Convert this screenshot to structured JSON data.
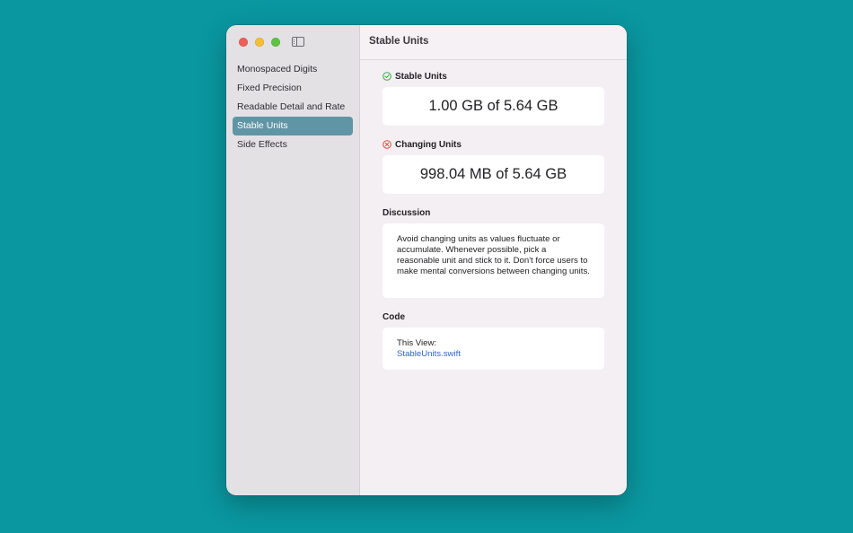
{
  "window": {
    "title": "Stable Units",
    "traffic_colors": {
      "close": "#ee5f58",
      "minimize": "#f7be34",
      "zoom": "#5ec440"
    }
  },
  "sidebar": {
    "items": [
      {
        "label": "Monospaced Digits",
        "selected": false
      },
      {
        "label": "Fixed Precision",
        "selected": false
      },
      {
        "label": "Readable Detail and Rate",
        "selected": false
      },
      {
        "label": "Stable Units",
        "selected": true
      },
      {
        "label": "Side Effects",
        "selected": false
      }
    ],
    "selection_color": "#6095a6"
  },
  "main": {
    "good": {
      "heading": "Stable Units",
      "icon": "checkmark-circle-icon",
      "icon_color": "#34b042",
      "value": "1.00 GB of 5.64 GB"
    },
    "bad": {
      "heading": "Changing Units",
      "icon": "xmark-circle-icon",
      "icon_color": "#e0483e",
      "value": "998.04 MB of 5.64 GB"
    },
    "discussion": {
      "heading": "Discussion",
      "text": "Avoid changing units as values fluctuate or accumulate. Whenever possible, pick a reasonable unit and stick to it. Don't force users to make mental conversions between changing units."
    },
    "code": {
      "heading": "Code",
      "label": "This View:",
      "link": "StableUnits.swift",
      "link_color": "#2e64c4"
    }
  }
}
